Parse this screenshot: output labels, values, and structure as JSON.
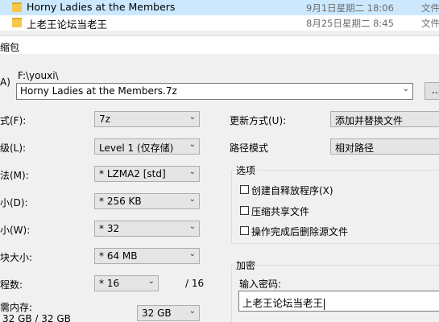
{
  "file_list": {
    "rows": [
      {
        "name": "Horny Ladies at the Members",
        "date": "9月1日星期二 18:06",
        "type": "文件",
        "selected": true
      },
      {
        "name": "上老王论坛当老王",
        "date": "8月25日星期二 8:45",
        "type": "文件",
        "selected": false
      }
    ]
  },
  "dialog": {
    "title": "缩包",
    "archive_label_partial": "A)",
    "path_prefix": "F:\\youxi\\",
    "archive_name": "Horny Ladies at the Members.7z",
    "browse_label": "...",
    "left_fields": [
      {
        "label": "式(F):",
        "value": "7z"
      },
      {
        "label": "级(L):",
        "value": "Level 1 (仅存储)"
      },
      {
        "label": "法(M):",
        "value": "* LZMA2 [std]"
      },
      {
        "label": "小(D):",
        "value": "* 256 KB"
      },
      {
        "label": "小(W):",
        "value": "* 32"
      },
      {
        "label": "块大小:",
        "value": "* 64 MB"
      },
      {
        "label": "程数:",
        "value": "* 16"
      }
    ],
    "threads_total": "/ 16",
    "memory_label": "需内存:",
    "memory_usage": "32 GB / 32 GB",
    "memory_value": "32 GB",
    "update_mode_label": "更新方式(U):",
    "update_mode_value": "添加并替换文件",
    "path_mode_label": "路径模式",
    "path_mode_value": "相对路径",
    "options": {
      "title": "选项",
      "items": [
        {
          "label": "创建自释放程序(X)",
          "checked": false
        },
        {
          "label": "压缩共享文件",
          "checked": false
        },
        {
          "label": "操作完成后删除源文件",
          "checked": false
        }
      ]
    },
    "encryption": {
      "title": "加密",
      "password_label": "输入密码:",
      "password_value": "上老王论坛当老王"
    }
  },
  "colors": {
    "selection": "#cce8ff",
    "dialog_bg": "#f0f0f0",
    "folder": "#f5c84a"
  }
}
